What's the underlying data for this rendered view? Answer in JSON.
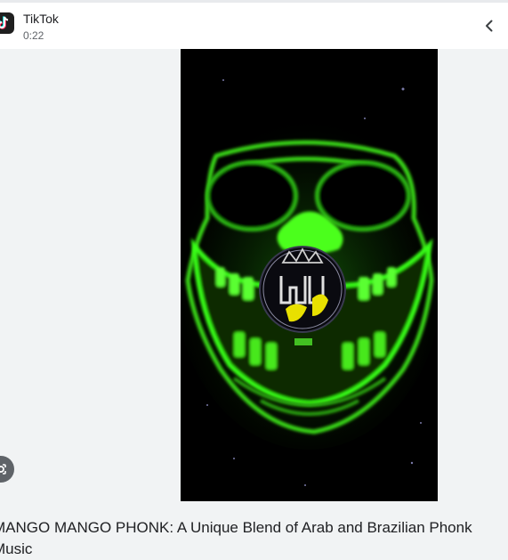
{
  "header": {
    "app_name": "TikTok",
    "duration": "0:22",
    "app_icon": "tiktok-icon",
    "back_icon": "chevron-left-icon"
  },
  "video": {
    "description": "green glowing clown face with yellow logo"
  },
  "fab": {
    "icon": "lens-icon"
  },
  "caption": {
    "text": "MANGO MANGO PHONK: A Unique Blend of Arab and Brazilian Phonk Music"
  },
  "colors": {
    "accent_green": "#39ff14",
    "logo_yellow": "#e8e000",
    "background": "#f1f3f4"
  }
}
